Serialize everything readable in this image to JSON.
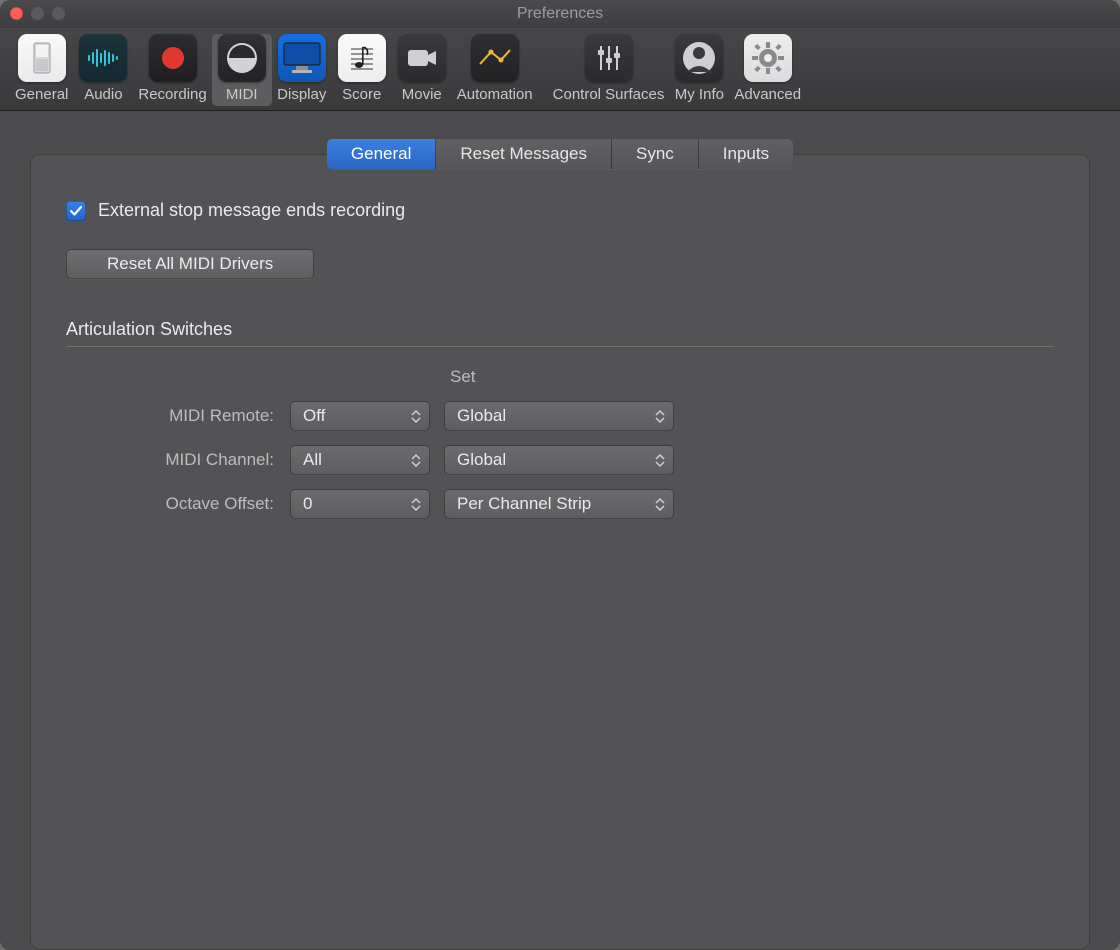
{
  "window": {
    "title": "Preferences"
  },
  "toolbar": {
    "items": [
      {
        "label": "General"
      },
      {
        "label": "Audio"
      },
      {
        "label": "Recording"
      },
      {
        "label": "MIDI"
      },
      {
        "label": "Display"
      },
      {
        "label": "Score"
      },
      {
        "label": "Movie"
      },
      {
        "label": "Automation"
      },
      {
        "label": "Control Surfaces"
      },
      {
        "label": "My Info"
      },
      {
        "label": "Advanced"
      }
    ]
  },
  "tabs": {
    "items": [
      {
        "label": "General"
      },
      {
        "label": "Reset Messages"
      },
      {
        "label": "Sync"
      },
      {
        "label": "Inputs"
      }
    ]
  },
  "general": {
    "external_stop_label": "External stop message ends recording",
    "external_stop_checked": true,
    "reset_drivers_label": "Reset All MIDI Drivers"
  },
  "section": {
    "title": "Articulation Switches",
    "set_header": "Set",
    "rows": {
      "midi_remote": {
        "label": "MIDI Remote:",
        "value": "Off",
        "set": "Global"
      },
      "midi_channel": {
        "label": "MIDI Channel:",
        "value": "All",
        "set": "Global"
      },
      "octave_offset": {
        "label": "Octave Offset:",
        "value": "0",
        "set": "Per Channel Strip"
      }
    }
  }
}
